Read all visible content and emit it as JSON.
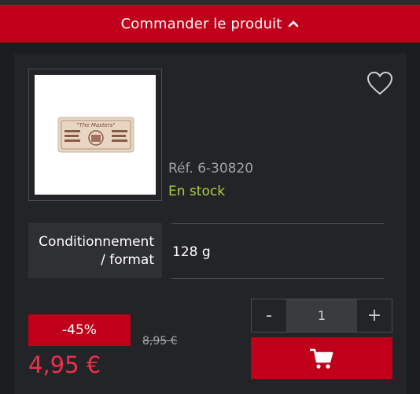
{
  "header": {
    "order_label": "Commander le produit"
  },
  "product": {
    "reference": "Réf. 6-30820",
    "stock_status": "En stock",
    "image_icon": "soap-bar-image"
  },
  "attributes": [
    {
      "label_line1": "Conditionnement",
      "label_line2": "/ format",
      "value": "128 g"
    }
  ],
  "pricing": {
    "discount": "-45%",
    "old_price": "8,95 €",
    "new_price": "4,95 €"
  },
  "quantity": {
    "minus": "-",
    "value": "1",
    "plus": "+"
  },
  "icons": {
    "wishlist": "heart-icon",
    "cart": "cart-icon",
    "toggle": "chevron-up-icon"
  },
  "colors": {
    "accent": "#c0001a",
    "price": "#f0304a",
    "stock": "#a8cd42",
    "background": "#1c1d1f"
  }
}
